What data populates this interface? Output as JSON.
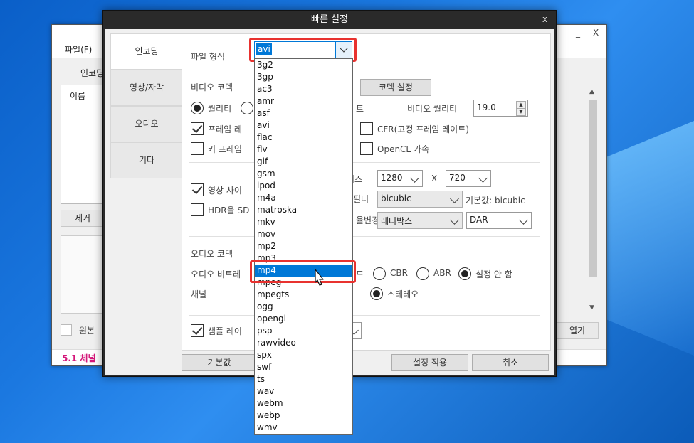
{
  "background_window": {
    "min_label": "_",
    "close_label": "X",
    "menu_file": "파일(F)",
    "tab_encoding_partial": "인코딩",
    "list_header": "이름",
    "remove_button_partial": "제거",
    "original_checkbox_label": "원본",
    "open_button_partial": "열기",
    "status_text": "5.1 체널"
  },
  "dialog": {
    "title": "빠른 설정",
    "close_label": "x",
    "tabs": [
      {
        "label": "인코딩",
        "active": true
      },
      {
        "label": "영상/자막",
        "active": false
      },
      {
        "label": "오디오",
        "active": false
      },
      {
        "label": "기타",
        "active": false
      }
    ],
    "file_format_label": "파일 형식",
    "file_format_value": "avi",
    "video_codec_label": "비디오 코덱",
    "codec_settings_button": "코덱 설정",
    "quality_radio_label": "퀄리티",
    "bitrate_partial": "트",
    "video_quality_label": "비디오 퀄리티",
    "video_quality_value": "19.0",
    "framerate_label_partial": "프레임 레",
    "cfr_label": "CFR(고정 프레임 레이트)",
    "keyframe_label_partial": "키 프레임",
    "opencl_label": "OpenCL 가속",
    "video_size_label_partial": "영상 사이",
    "size_label_partial": "이즈",
    "width_value": "1280",
    "x_label": "X",
    "height_value": "720",
    "hdr_label_partial": "HDR을 SD",
    "filter_label": "필터",
    "filter_value": "bicubic",
    "default_filter_label": "기본값: bicubic",
    "aspect_label_partial": "율변경",
    "aspect_mode_value": "레터박스",
    "aspect_type_value": "DAR",
    "audio_codec_label": "오디오 코덱",
    "audio_bitrate_label_partial": "오디오 비트레",
    "audio_mode_label_partial": "드",
    "cbr_label": "CBR",
    "abr_label": "ABR",
    "no_setting_label": "설정 안 함",
    "channel_label": "채널",
    "stereo_label": "스테레오",
    "sample_rate_label_partial": "샘플 레이",
    "default_button": "기본값",
    "apply_button": "설정 적용",
    "cancel_button": "취소"
  },
  "dropdown": {
    "options": [
      "3g2",
      "3gp",
      "ac3",
      "amr",
      "asf",
      "avi",
      "flac",
      "flv",
      "gif",
      "gsm",
      "ipod",
      "m4a",
      "matroska",
      "mkv",
      "mov",
      "mp2",
      "mp3",
      "mp4",
      "mpeg",
      "mpegts",
      "ogg",
      "opengl",
      "psp",
      "rawvideo",
      "spx",
      "swf",
      "ts",
      "wav",
      "webm",
      "webp",
      "wmv"
    ],
    "highlighted": "mp4"
  },
  "colors": {
    "highlight_box": "#e8322f",
    "selection": "#0078d7",
    "status_text": "#d4177a"
  }
}
